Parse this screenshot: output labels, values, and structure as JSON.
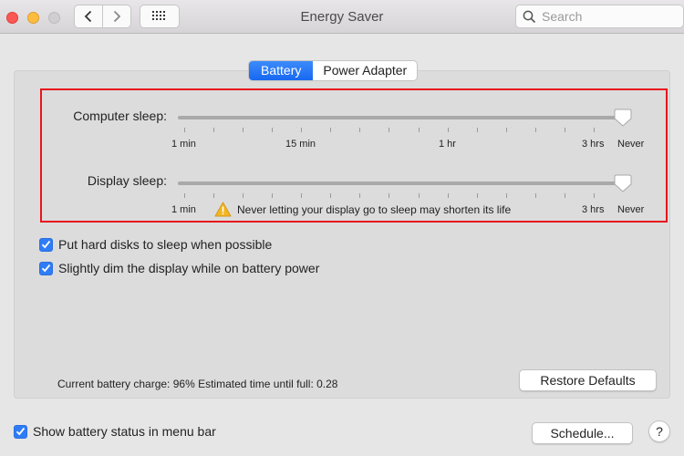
{
  "window": {
    "title": "Energy Saver",
    "search_placeholder": "Search"
  },
  "tabs": [
    {
      "label": "Battery",
      "active": true
    },
    {
      "label": "Power Adapter",
      "active": false
    }
  ],
  "sliders": {
    "tick_count": 16,
    "computer_sleep": {
      "label": "Computer sleep:",
      "value": "Never",
      "position_fraction": 1.0,
      "tick_labels": [
        "1 min",
        "15 min",
        "1 hr",
        "3 hrs",
        "Never"
      ]
    },
    "display_sleep": {
      "label": "Display sleep:",
      "value": "Never",
      "position_fraction": 1.0,
      "tick_labels": [
        "1 min",
        "3 hrs",
        "Never"
      ],
      "warning": "Never letting your display go to sleep may shorten its life"
    }
  },
  "options": [
    {
      "label": "Put hard disks to sleep when possible",
      "checked": true
    },
    {
      "label": "Slightly dim the display while on battery power",
      "checked": true
    }
  ],
  "status": {
    "text": "Current battery charge: 96%  Estimated time until full: 0.28",
    "charge_percent": 96,
    "time_until_full": "0.28"
  },
  "buttons": {
    "restore_defaults": "Restore Defaults",
    "schedule": "Schedule...",
    "help": "?"
  },
  "menu_bar_option": {
    "label": "Show battery status in menu bar",
    "checked": true
  },
  "colors": {
    "accent": "#1a6cf3",
    "highlight_box": "#e8151c",
    "close": "#fc5753",
    "minimize": "#fdbc40"
  }
}
